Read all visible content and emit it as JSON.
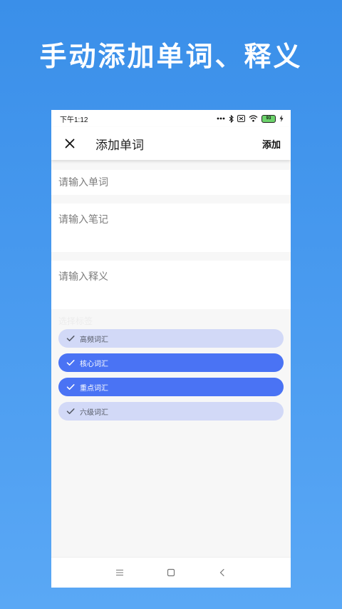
{
  "promo": {
    "headline": "手动添加单词、释义"
  },
  "status_bar": {
    "time": "下午1:12",
    "battery": "93",
    "icons": [
      "dots-icon",
      "bluetooth-icon",
      "sim-icon",
      "wifi-icon",
      "battery-icon",
      "charging-icon"
    ]
  },
  "toolbar": {
    "title": "添加单词",
    "close_icon": "close-icon",
    "add_label": "添加"
  },
  "form": {
    "word_placeholder": "请输入单词",
    "note_placeholder": "请输入笔记",
    "meaning_placeholder": "请输入释义",
    "word_value": "",
    "note_value": "",
    "meaning_value": "",
    "tags_label": "选择标签"
  },
  "tags": [
    {
      "label": "高频词汇",
      "selected": false
    },
    {
      "label": "核心词汇",
      "selected": true
    },
    {
      "label": "重点词汇",
      "selected": true
    },
    {
      "label": "六级词汇",
      "selected": false
    }
  ],
  "navbar": {
    "icons": [
      "menu-icon",
      "home-icon",
      "back-icon"
    ]
  },
  "colors": {
    "background_top": "#3a8fe9",
    "chip_selected": "#4a73f4",
    "chip_unselected": "#d2d9f7"
  }
}
